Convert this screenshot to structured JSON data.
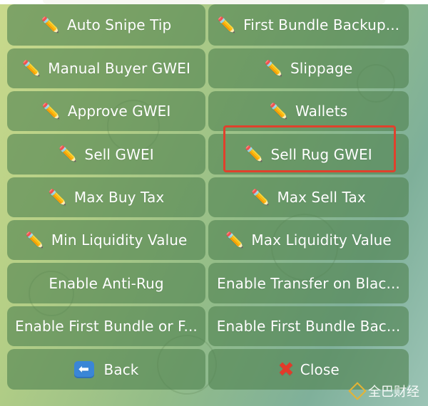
{
  "keyboard": {
    "buttons": [
      {
        "icon": "✏️",
        "label": "Auto Snipe Tip"
      },
      {
        "icon": "✏️",
        "label": "First Bundle Backup..."
      },
      {
        "icon": "✏️",
        "label": "Manual Buyer GWEI"
      },
      {
        "icon": "✏️",
        "label": "Slippage"
      },
      {
        "icon": "✏️",
        "label": "Approve GWEI"
      },
      {
        "icon": "✏️",
        "label": "Wallets"
      },
      {
        "icon": "✏️",
        "label": "Sell GWEI"
      },
      {
        "icon": "✏️",
        "label": "Sell Rug GWEI"
      },
      {
        "icon": "✏️",
        "label": "Max Buy Tax"
      },
      {
        "icon": "✏️",
        "label": "Max Sell Tax"
      },
      {
        "icon": "✏️",
        "label": "Min Liquidity Value"
      },
      {
        "icon": "✏️",
        "label": "Max Liquidity Value"
      },
      {
        "label": "Enable Anti-Rug"
      },
      {
        "label": "Enable Transfer on Blac..."
      },
      {
        "label": "Enable First Bundle or F..."
      },
      {
        "label": "Enable First Bundle Bac..."
      }
    ],
    "back": {
      "icon": "⬅",
      "label": "Back"
    },
    "close": {
      "icon": "✖",
      "label": "Close"
    }
  },
  "highlight_color": "#e0412c",
  "watermark": {
    "text": "全巴财经"
  }
}
